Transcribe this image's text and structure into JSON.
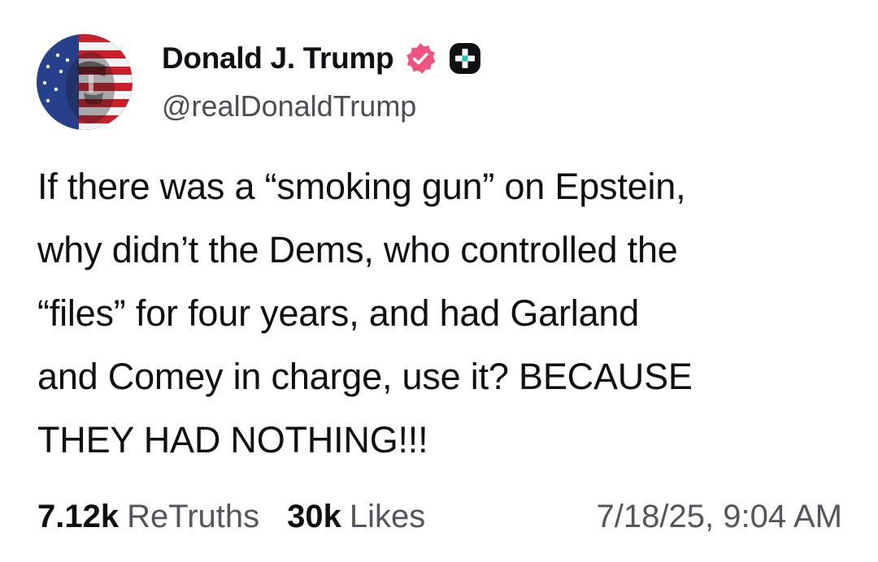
{
  "author": {
    "display_name": "Donald J. Trump",
    "handle": "@realDonaldTrump",
    "verified_color": "#f2527f",
    "badge_icon": "plus-badge-icon"
  },
  "post": {
    "lines": [
      "If there was a “smoking gun” on Epstein,",
      "why didn’t the Dems, who controlled the",
      "“files” for four years, and had Garland",
      "and Comey in charge, use it? BECAUSE",
      "THEY HAD NOTHING!!!"
    ]
  },
  "stats": {
    "retruths_count": "7.12k",
    "retruths_label": "ReTruths",
    "likes_count": "30k",
    "likes_label": "Likes",
    "timestamp": "7/18/25, 9:04 AM"
  }
}
